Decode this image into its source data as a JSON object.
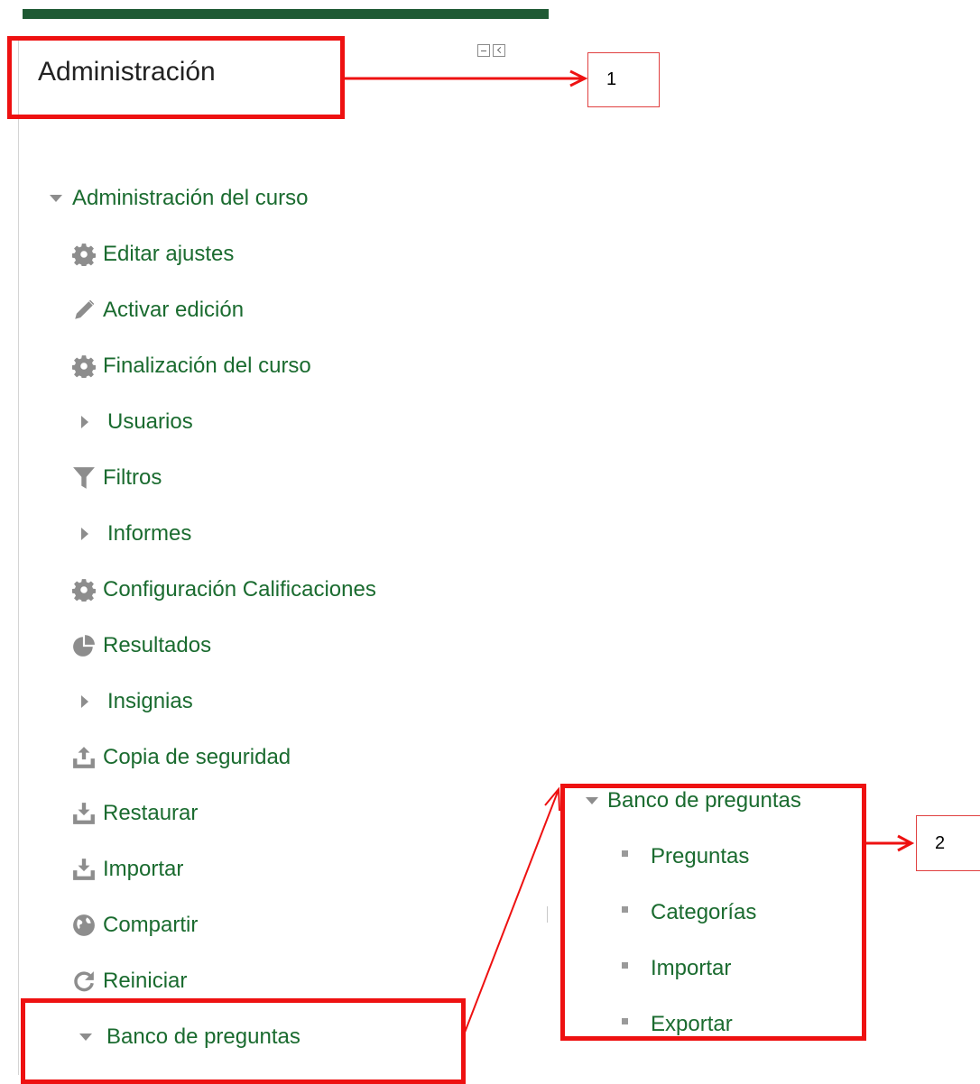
{
  "block": {
    "title": "Administración",
    "controls": [
      "hide-block",
      "dock-block"
    ]
  },
  "course_admin": {
    "label": "Administración del curso",
    "items": [
      {
        "label": "Editar ajustes",
        "icon": "gear-icon"
      },
      {
        "label": "Activar edición",
        "icon": "pencil-icon"
      },
      {
        "label": "Finalización del curso",
        "icon": "gear-icon"
      },
      {
        "label": "Usuarios",
        "icon": "caret-right-icon"
      },
      {
        "label": "Filtros",
        "icon": "filter-icon"
      },
      {
        "label": "Informes",
        "icon": "caret-right-icon"
      },
      {
        "label": "Configuración Calificaciones",
        "icon": "gear-icon"
      },
      {
        "label": "Resultados",
        "icon": "pie-chart-icon"
      },
      {
        "label": "Insignias",
        "icon": "caret-right-icon"
      },
      {
        "label": "Copia de seguridad",
        "icon": "upload-icon"
      },
      {
        "label": "Restaurar",
        "icon": "download-icon"
      },
      {
        "label": "Importar",
        "icon": "download-icon"
      },
      {
        "label": "Compartir",
        "icon": "globe-icon"
      },
      {
        "label": "Reiniciar",
        "icon": "refresh-icon"
      },
      {
        "label": "Banco de preguntas",
        "icon": "caret-down-icon"
      }
    ]
  },
  "question_bank_popout": {
    "label": "Banco de preguntas",
    "items": [
      "Preguntas",
      "Categorías",
      "Importar",
      "Exportar"
    ]
  },
  "callouts": {
    "one": "1",
    "two": "2"
  },
  "colors": {
    "accent_bar": "#1f5a34",
    "link_green": "#1a6b2f",
    "annotation_red": "#ee1111"
  }
}
